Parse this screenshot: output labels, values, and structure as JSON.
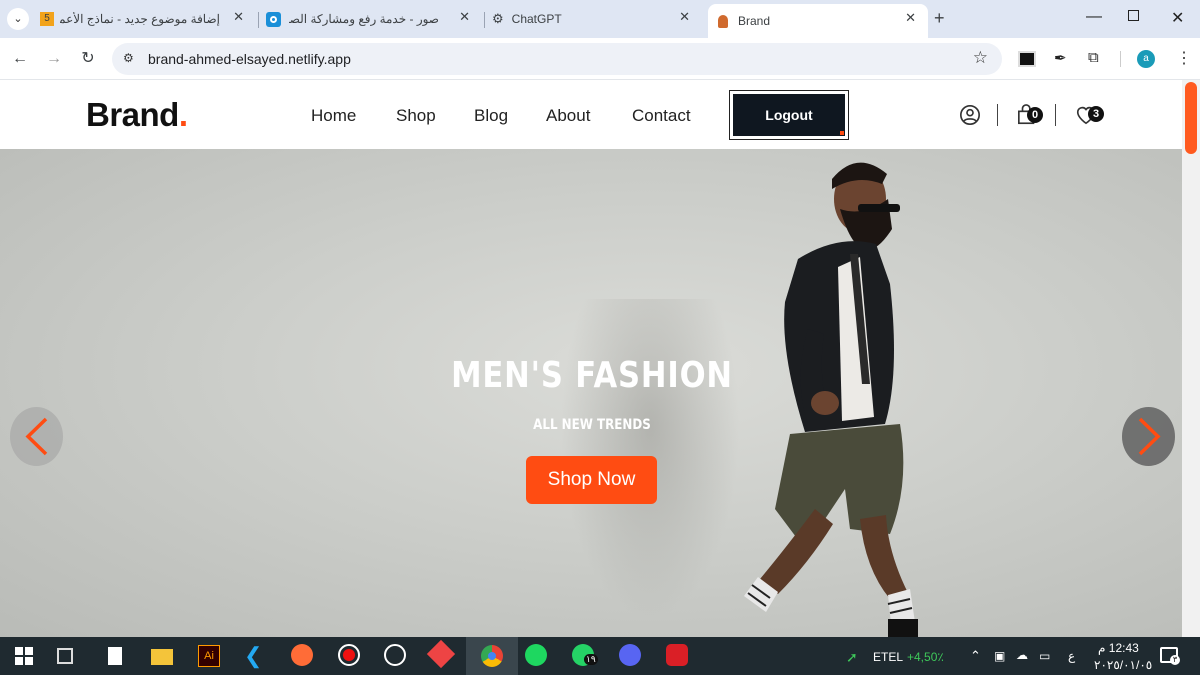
{
  "browser": {
    "tabs": [
      {
        "title": "إضافة موضوع جديد - نماذج الأعمال",
        "favicon_text": "5"
      },
      {
        "title": "صور - خدمة رفع ومشاركة الصور"
      },
      {
        "title": "ChatGPT"
      },
      {
        "title": "Brand"
      }
    ],
    "url": "brand-ahmed-elsayed.netlify.app",
    "profile_initial": "a"
  },
  "site": {
    "logo_text": "Brand",
    "logo_dot": ".",
    "nav": [
      "Home",
      "Shop",
      "Blog",
      "About",
      "Contact"
    ],
    "logout_label": "Logout",
    "cart_count": "0",
    "wishlist_count": "3"
  },
  "hero": {
    "title": "MEN'S FASHION",
    "subtitle": "ALL NEW TRENDS",
    "cta": "Shop Now"
  },
  "taskbar": {
    "stock_name": "ETEL",
    "stock_change": "+4,50٪",
    "time": "12:43 م",
    "date": "٢٠٢٥/٠١/٠٥",
    "lang": "ع",
    "whatsapp_badge": "١٩",
    "notif_count": "٣"
  },
  "colors": {
    "accent": "#ff4c12",
    "dark": "#0f1720",
    "taskbar": "#1f2a30",
    "tabbar": "#dfe6f3"
  }
}
